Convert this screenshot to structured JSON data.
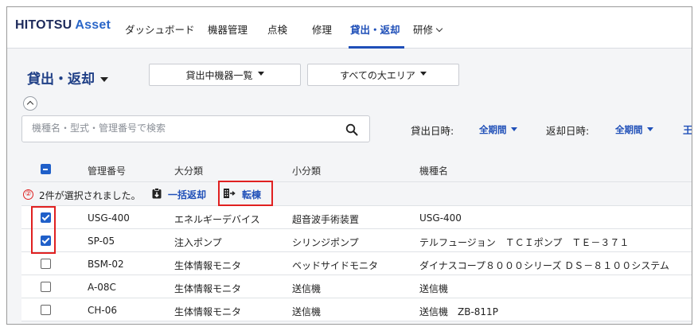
{
  "header": {
    "logo_main": "HITOTSU",
    "logo_sub": "Asset",
    "nav": [
      {
        "label": "ダッシュボード"
      },
      {
        "label": "機器管理"
      },
      {
        "label": "点検"
      },
      {
        "label": "修理"
      },
      {
        "label": "貸出・返却"
      },
      {
        "label": "研修"
      }
    ],
    "active_nav": "貸出・返却",
    "accent_color": "#1f4fb8"
  },
  "page": {
    "title": "貸出・返却",
    "view_select": "貸出中機器一覧",
    "area_select": "すべての大エリア"
  },
  "search": {
    "placeholder": "機種名・型式・管理番号で検索",
    "value": ""
  },
  "filters": {
    "lend_label": "貸出日時:",
    "lend_value": "全期間",
    "return_label": "返却日時:",
    "return_value": "全期間",
    "cut_off_glyph": "王"
  },
  "table": {
    "columns": [
      "管理番号",
      "大分類",
      "小分類",
      "機種名"
    ],
    "header_checkbox": "indeterminate",
    "selection": {
      "step_marker": "②",
      "text": "2件が選択されました。",
      "bulk_return_label": "一括返却",
      "transfer_label": "転棟"
    },
    "rows": [
      {
        "checked": true,
        "id": "USG-400",
        "major": "エネルギーデバイス",
        "minor": "超音波手術装置",
        "model": "USG-400"
      },
      {
        "checked": true,
        "id": "SP-05",
        "major": "注入ポンプ",
        "minor": "シリンジポンプ",
        "model": "テルフュージョン　ＴＣＩポンプ　ＴＥ－３７１"
      },
      {
        "checked": false,
        "id": "BSM-02",
        "major": "生体情報モニタ",
        "minor": "ベッドサイドモニタ",
        "model": "ダイナスコープ８０００シリーズ ＤＳ－８１００システム"
      },
      {
        "checked": false,
        "id": "A-08C",
        "major": "生体情報モニタ",
        "minor": "送信機",
        "model": "送信機"
      },
      {
        "checked": false,
        "id": "CH-06",
        "major": "生体情報モニタ",
        "minor": "送信機",
        "model": "送信機　ZB-811P"
      }
    ]
  },
  "icons": {
    "search": "search-icon",
    "bulk_return": "clipboard-return-icon",
    "transfer": "transfer-icon",
    "collapse": "chevron-up-icon"
  },
  "highlight_color": "#e02020"
}
